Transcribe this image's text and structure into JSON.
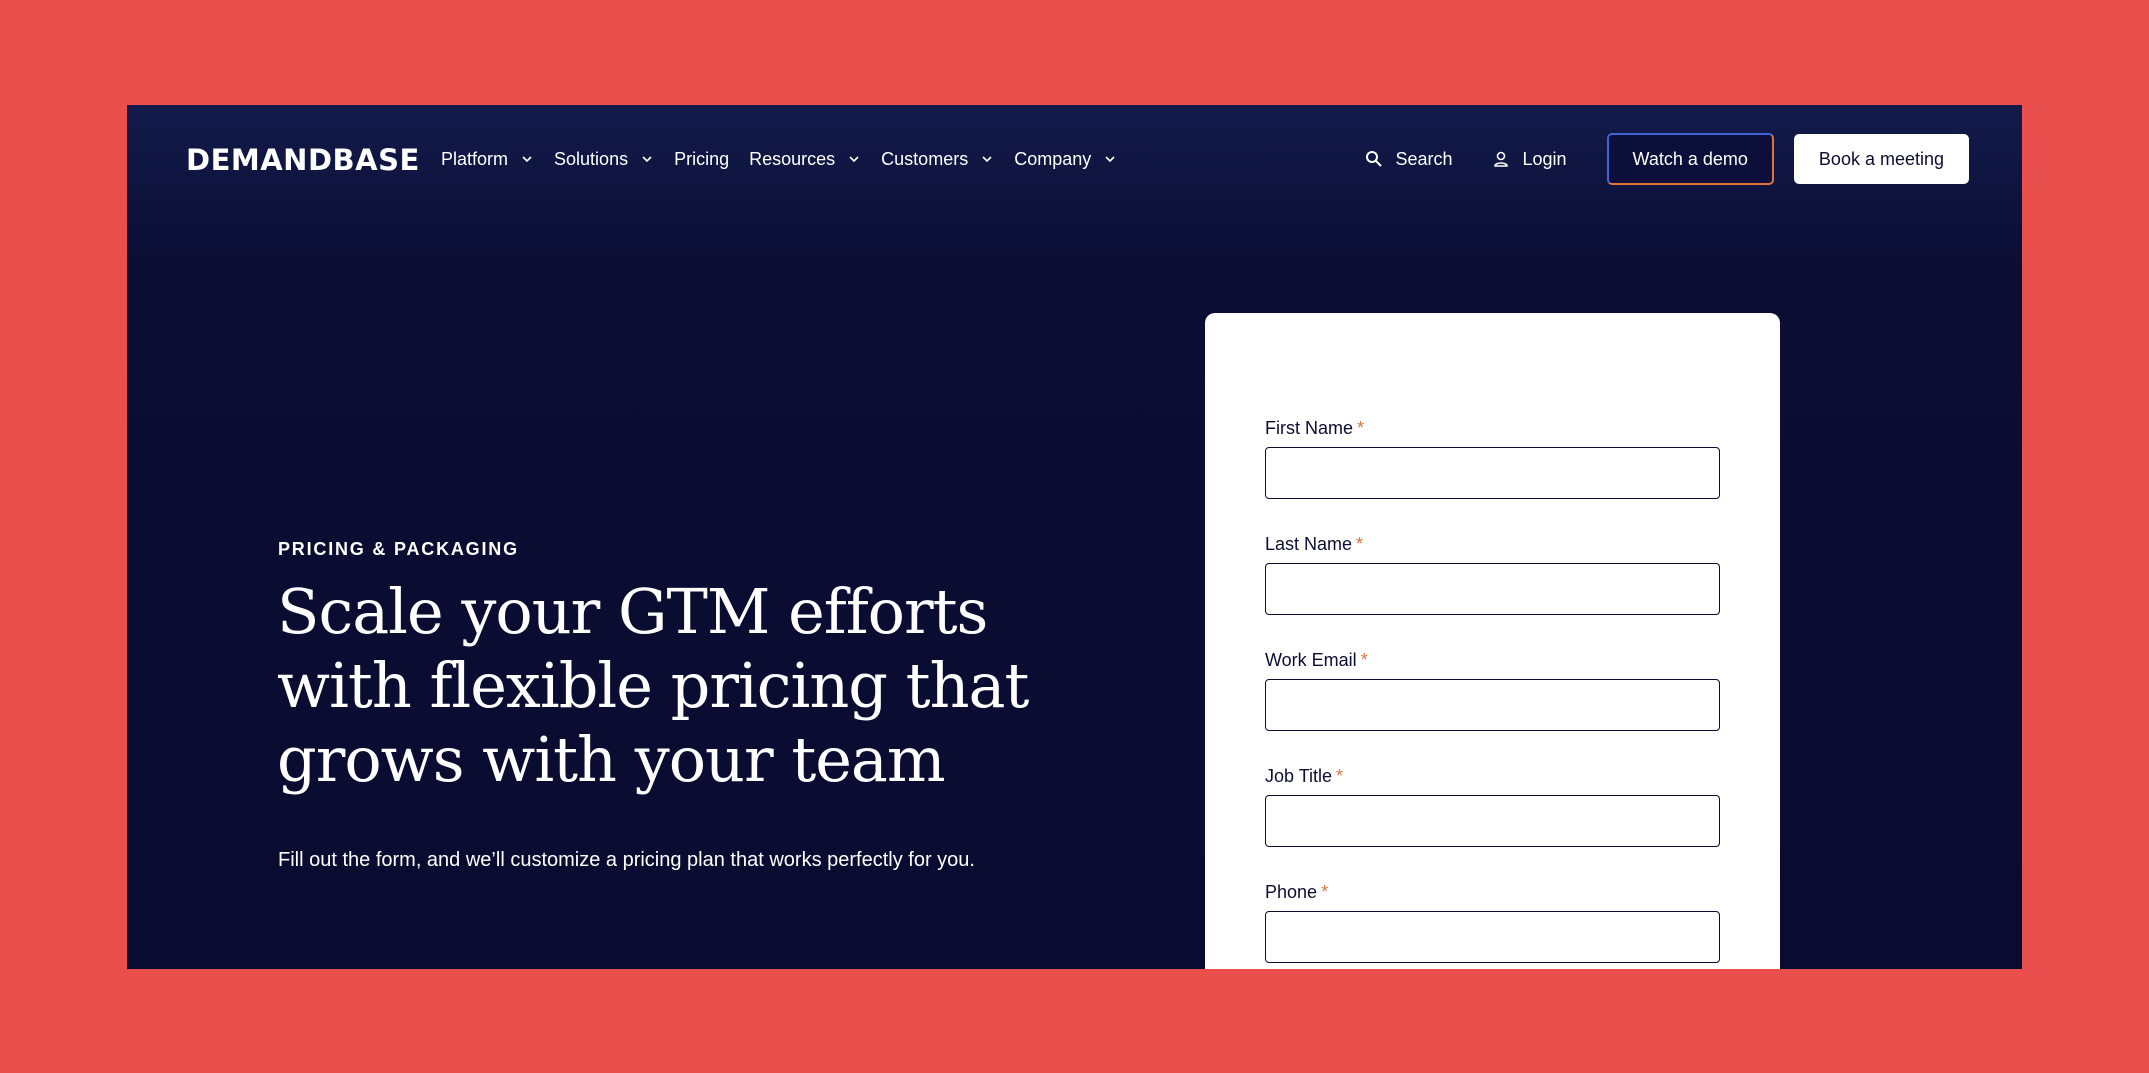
{
  "nav": {
    "logo": "DEMANDBASE",
    "menu": [
      {
        "label": "Platform",
        "has_dropdown": true
      },
      {
        "label": "Solutions",
        "has_dropdown": true
      },
      {
        "label": "Pricing",
        "has_dropdown": false
      },
      {
        "label": "Resources",
        "has_dropdown": true
      },
      {
        "label": "Customers",
        "has_dropdown": true
      },
      {
        "label": "Company",
        "has_dropdown": true
      }
    ],
    "search_label": "Search",
    "login_label": "Login",
    "watch_demo_label": "Watch a demo",
    "book_meeting_label": "Book a meeting"
  },
  "hero": {
    "eyebrow": "PRICING & PACKAGING",
    "headline": "Scale your GTM efforts with flexible pricing that grows with your team",
    "subtext": "Fill out the form, and we’ll customize a pricing plan that works perfectly for you."
  },
  "form": {
    "fields": [
      {
        "label": "First Name",
        "required_mark": "*",
        "value": ""
      },
      {
        "label": "Last Name",
        "required_mark": "*",
        "value": ""
      },
      {
        "label": "Work Email",
        "required_mark": "*",
        "value": ""
      },
      {
        "label": "Job Title",
        "required_mark": "*",
        "value": ""
      },
      {
        "label": "Phone",
        "required_mark": "*",
        "value": ""
      }
    ]
  },
  "colors": {
    "page_background": "#e94f4d",
    "hero_background": "#0a0b31",
    "accent_orange": "#e0743c",
    "accent_blue": "#3e64d8"
  }
}
